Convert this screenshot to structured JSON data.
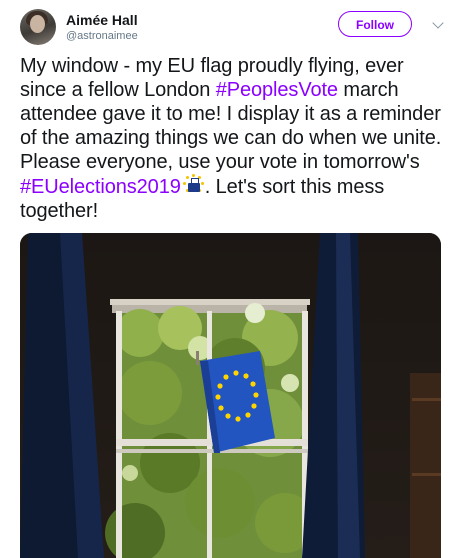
{
  "author": {
    "name": "Aimée Hall",
    "handle": "@astronaimee",
    "avatar_icon": "user-avatar"
  },
  "follow_label": "Follow",
  "menu_icon": "chevron-down-icon",
  "tweet": {
    "t1": "My window - my EU flag proudly flying, ever since a fellow London ",
    "hashtag1": "#PeoplesVote",
    "t2": " march attendee gave it to me! I display it as a reminder of the amazing things we can do when we unite. Please everyone, use your vote in tomorrow's ",
    "hashtag2": "#EUelections2019",
    "emoji_icon": "ballot-box-eu-icon",
    "t3": ". Let's sort this mess together!"
  },
  "colors": {
    "accent": "#8b00ff",
    "flag_blue": "#2255c0",
    "flag_star": "#ffd400"
  },
  "media": {
    "alt_description_icon": "eu-flag-window-photo"
  }
}
